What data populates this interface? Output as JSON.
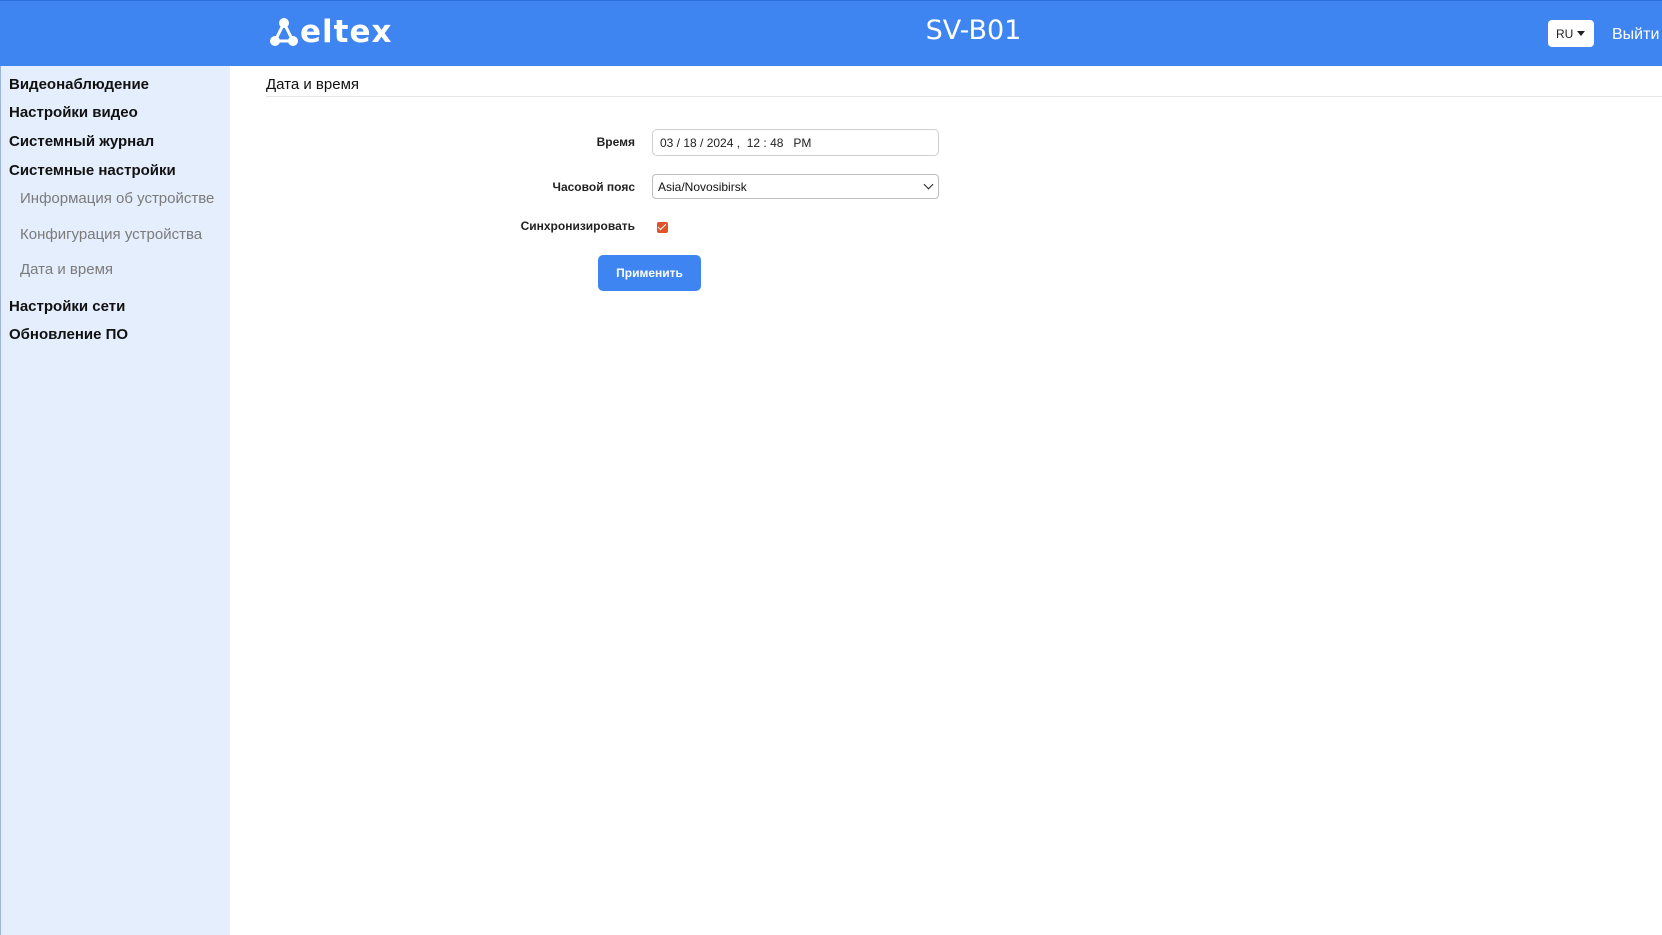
{
  "header": {
    "brand": "eltex",
    "device_name": "SV-B01",
    "language": "RU",
    "logout_label": "Выйти"
  },
  "sidebar": {
    "sections": [
      {
        "label": "Видеонаблюдение"
      },
      {
        "label": "Настройки видео"
      },
      {
        "label": "Системный журнал"
      },
      {
        "label": "Системные настройки"
      },
      {
        "label": "Настройки сети"
      },
      {
        "label": "Обновление ПО"
      }
    ],
    "system_subitems": [
      {
        "label": "Информация об устройстве"
      },
      {
        "label": "Конфигурация устройства"
      },
      {
        "label": "Дата и время"
      }
    ]
  },
  "main": {
    "title": "Дата и время",
    "form": {
      "time_label": "Время",
      "time_value": "03 / 18 / 2024 ,  12 : 48   PM",
      "timezone_label": "Часовой пояс",
      "timezone_value": "Asia/Novosibirsk",
      "sync_label": "Синхронизировать",
      "sync_checked": true,
      "apply_label": "Применить"
    }
  },
  "colors": {
    "header_bg": "#3f85f2",
    "sidebar_bg": "#e4eefc",
    "checkbox": "#e0522a"
  }
}
